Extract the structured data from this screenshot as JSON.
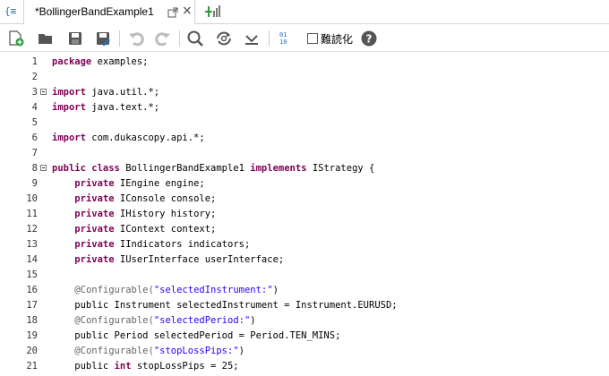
{
  "tabbar": {
    "left_icon": "{≡",
    "tab_title": "*BollingerBandExample1",
    "close_glyph": "×"
  },
  "toolbar": {
    "icons": [
      "new-file-icon",
      "open-folder-icon",
      "save-icon",
      "save-as-icon",
      "undo-icon",
      "redo-icon",
      "search-icon",
      "replace-icon",
      "download-icon",
      "format-icon",
      "help-icon"
    ],
    "readable_label": "難読化",
    "help_glyph": "?"
  },
  "colors": {
    "keyword": "#7f0055",
    "string": "#2a00ff",
    "annotation": "#646464",
    "accent_green": "#2e9c3a",
    "toolbar_blue": "#2a6db0"
  },
  "editor": {
    "lines": [
      {
        "num": "1",
        "fold": false,
        "tokens": [
          {
            "t": "package",
            "c": "kw"
          },
          {
            "t": " examples;"
          }
        ]
      },
      {
        "num": "2",
        "fold": false,
        "tokens": []
      },
      {
        "num": "3",
        "fold": true,
        "tokens": [
          {
            "t": "import",
            "c": "kw"
          },
          {
            "t": " java.util.*;"
          }
        ]
      },
      {
        "num": "4",
        "fold": false,
        "tokens": [
          {
            "t": "import",
            "c": "kw"
          },
          {
            "t": " java.text.*;"
          }
        ]
      },
      {
        "num": "5",
        "fold": false,
        "tokens": []
      },
      {
        "num": "6",
        "fold": false,
        "tokens": [
          {
            "t": "import",
            "c": "kw"
          },
          {
            "t": " com.dukascopy.api.*;"
          }
        ]
      },
      {
        "num": "7",
        "fold": false,
        "tokens": []
      },
      {
        "num": "8",
        "fold": true,
        "tokens": [
          {
            "t": "public",
            "c": "kw"
          },
          {
            "t": " "
          },
          {
            "t": "class",
            "c": "kw"
          },
          {
            "t": " BollingerBandExample1 "
          },
          {
            "t": "implements",
            "c": "kw"
          },
          {
            "t": " IStrategy {"
          }
        ]
      },
      {
        "num": "9",
        "fold": false,
        "tokens": [
          {
            "t": "    "
          },
          {
            "t": "private",
            "c": "kw"
          },
          {
            "t": " IEngine engine;"
          }
        ]
      },
      {
        "num": "10",
        "fold": false,
        "tokens": [
          {
            "t": "    "
          },
          {
            "t": "private",
            "c": "kw"
          },
          {
            "t": " IConsole console;"
          }
        ]
      },
      {
        "num": "11",
        "fold": false,
        "tokens": [
          {
            "t": "    "
          },
          {
            "t": "private",
            "c": "kw"
          },
          {
            "t": " IHistory history;"
          }
        ]
      },
      {
        "num": "12",
        "fold": false,
        "tokens": [
          {
            "t": "    "
          },
          {
            "t": "private",
            "c": "kw"
          },
          {
            "t": " IContext context;"
          }
        ]
      },
      {
        "num": "13",
        "fold": false,
        "tokens": [
          {
            "t": "    "
          },
          {
            "t": "private",
            "c": "kw"
          },
          {
            "t": " IIndicators indicators;"
          }
        ]
      },
      {
        "num": "14",
        "fold": false,
        "tokens": [
          {
            "t": "    "
          },
          {
            "t": "private",
            "c": "kw"
          },
          {
            "t": " IUserInterface userInterface;"
          }
        ]
      },
      {
        "num": "15",
        "fold": false,
        "tokens": []
      },
      {
        "num": "16",
        "fold": false,
        "tokens": [
          {
            "t": "    "
          },
          {
            "t": "@Configurable(",
            "c": "ann"
          },
          {
            "t": "\"selectedInstrument:\"",
            "c": "str"
          },
          {
            "t": ")"
          }
        ]
      },
      {
        "num": "17",
        "fold": false,
        "tokens": [
          {
            "t": "    public Instrument selectedInstrument = Instrument.EURUSD;"
          }
        ]
      },
      {
        "num": "18",
        "fold": false,
        "tokens": [
          {
            "t": "    "
          },
          {
            "t": "@Configurable(",
            "c": "ann"
          },
          {
            "t": "\"selectedPeriod:\"",
            "c": "str"
          },
          {
            "t": ")"
          }
        ]
      },
      {
        "num": "19",
        "fold": false,
        "tokens": [
          {
            "t": "    public Period selectedPeriod = Period.TEN_MINS;"
          }
        ]
      },
      {
        "num": "20",
        "fold": false,
        "tokens": [
          {
            "t": "    "
          },
          {
            "t": "@Configurable(",
            "c": "ann"
          },
          {
            "t": "\"stopLossPips:\"",
            "c": "str"
          },
          {
            "t": ")"
          }
        ]
      },
      {
        "num": "21",
        "fold": false,
        "tokens": [
          {
            "t": "    public "
          },
          {
            "t": "int",
            "c": "kw"
          },
          {
            "t": " stopLossPips = 25;"
          }
        ]
      }
    ]
  }
}
